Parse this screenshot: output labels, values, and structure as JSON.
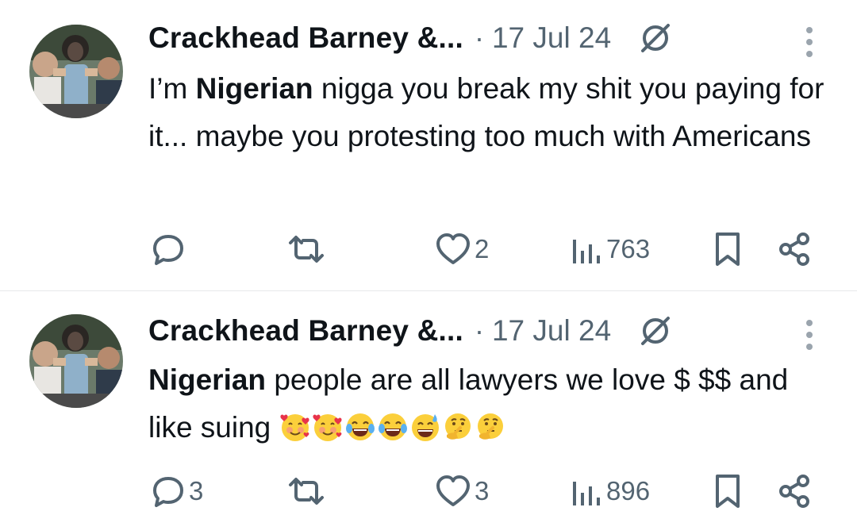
{
  "tweets": [
    {
      "author": "Crackhead Barney &...",
      "separator": "·",
      "date": "17 Jul 24",
      "text_bold": "Nigerian",
      "text_before": "I’m ",
      "text_after": " nigga you break my shit you paying for it... maybe you protesting too much with Americans",
      "emojis": [],
      "replies": "",
      "reposts": "",
      "likes": "2",
      "views": "763"
    },
    {
      "author": "Crackhead Barney &...",
      "separator": "·",
      "date": "17 Jul 24",
      "text_bold": "Nigerian",
      "text_before": "",
      "text_after": " people are all lawyers we love $ $$ and like suing ",
      "emojis": [
        "smiling-face-with-hearts",
        "smiling-face-with-hearts",
        "face-with-tears-of-joy",
        "face-with-tears-of-joy",
        "grinning-face-with-sweat",
        "thinking-face",
        "thinking-face"
      ],
      "replies": "3",
      "reposts": "",
      "likes": "3",
      "views": "896"
    }
  ],
  "colors": {
    "text": "#0f1419",
    "muted": "#536471",
    "divider": "#e7e9ea"
  },
  "icons": [
    "avatar",
    "grok-icon",
    "more-icon",
    "reply-icon",
    "repost-icon",
    "like-icon",
    "views-icon",
    "bookmark-icon",
    "share-icon"
  ]
}
